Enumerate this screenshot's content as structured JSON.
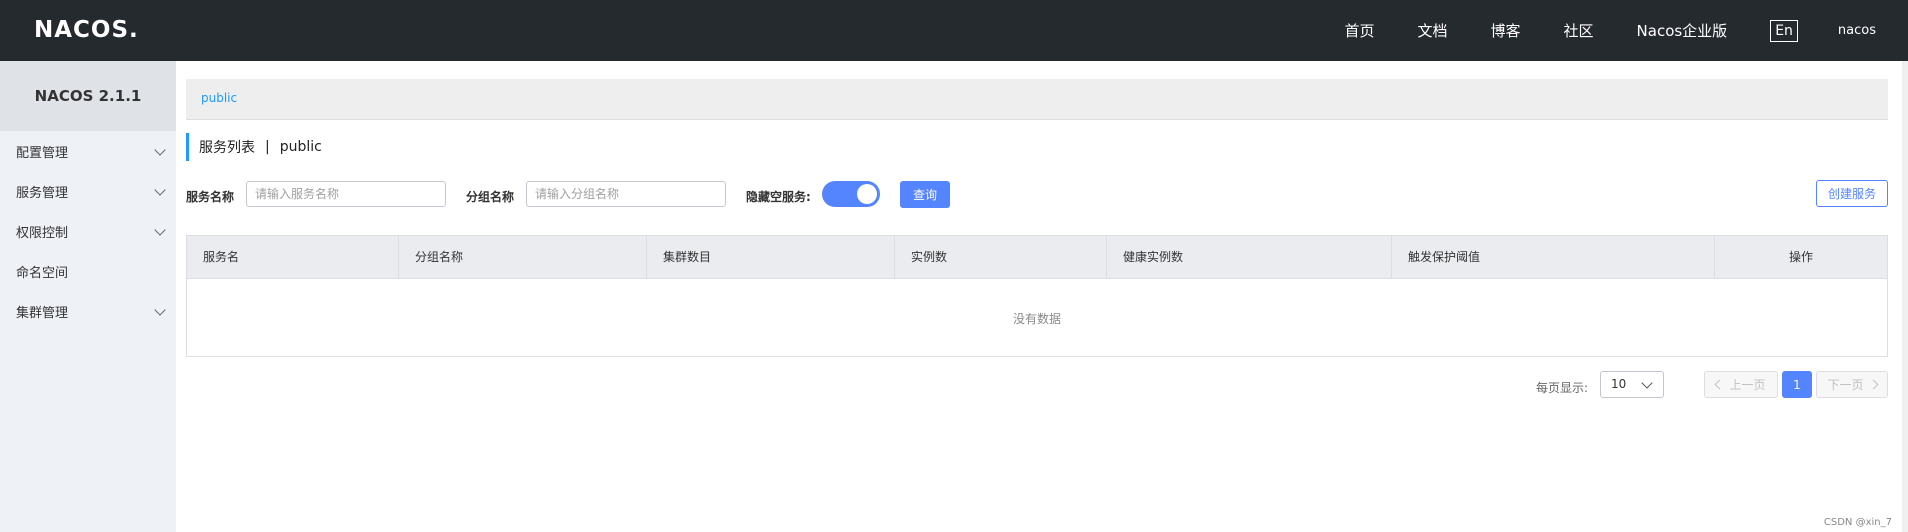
{
  "header": {
    "logo_text": "NACOS.",
    "nav": [
      "首页",
      "文档",
      "博客",
      "社区",
      "Nacos企业版"
    ],
    "lang_toggle": "En",
    "user": "nacos"
  },
  "sidebar": {
    "version": "NACOS 2.1.1",
    "items": [
      {
        "label": "配置管理",
        "expandable": true
      },
      {
        "label": "服务管理",
        "expandable": true
      },
      {
        "label": "权限控制",
        "expandable": true
      },
      {
        "label": "命名空间",
        "expandable": false
      },
      {
        "label": "集群管理",
        "expandable": true
      }
    ]
  },
  "namespace_bar": {
    "current": "public"
  },
  "page": {
    "title": "服务列表",
    "separator": "|",
    "namespace": "public"
  },
  "filters": {
    "service_name_label": "服务名称",
    "service_name_placeholder": "请输入服务名称",
    "group_name_label": "分组名称",
    "group_name_placeholder": "请输入分组名称",
    "hide_empty_label": "隐藏空服务:",
    "hide_empty_on": true,
    "query_button": "查询",
    "create_button": "创建服务"
  },
  "table": {
    "columns": [
      "服务名",
      "分组名称",
      "集群数目",
      "实例数",
      "健康实例数",
      "触发保护阈值",
      "操作"
    ],
    "rows": [],
    "empty_text": "没有数据"
  },
  "pagination": {
    "per_page_label": "每页显示:",
    "per_page_value": "10",
    "prev_label": "上一页",
    "current_page": "1",
    "next_label": "下一页"
  },
  "watermark": "CSDN @xin_7",
  "colors": {
    "primary": "#5584ff",
    "header_bg": "#252a2f",
    "link": "#209bfa"
  }
}
